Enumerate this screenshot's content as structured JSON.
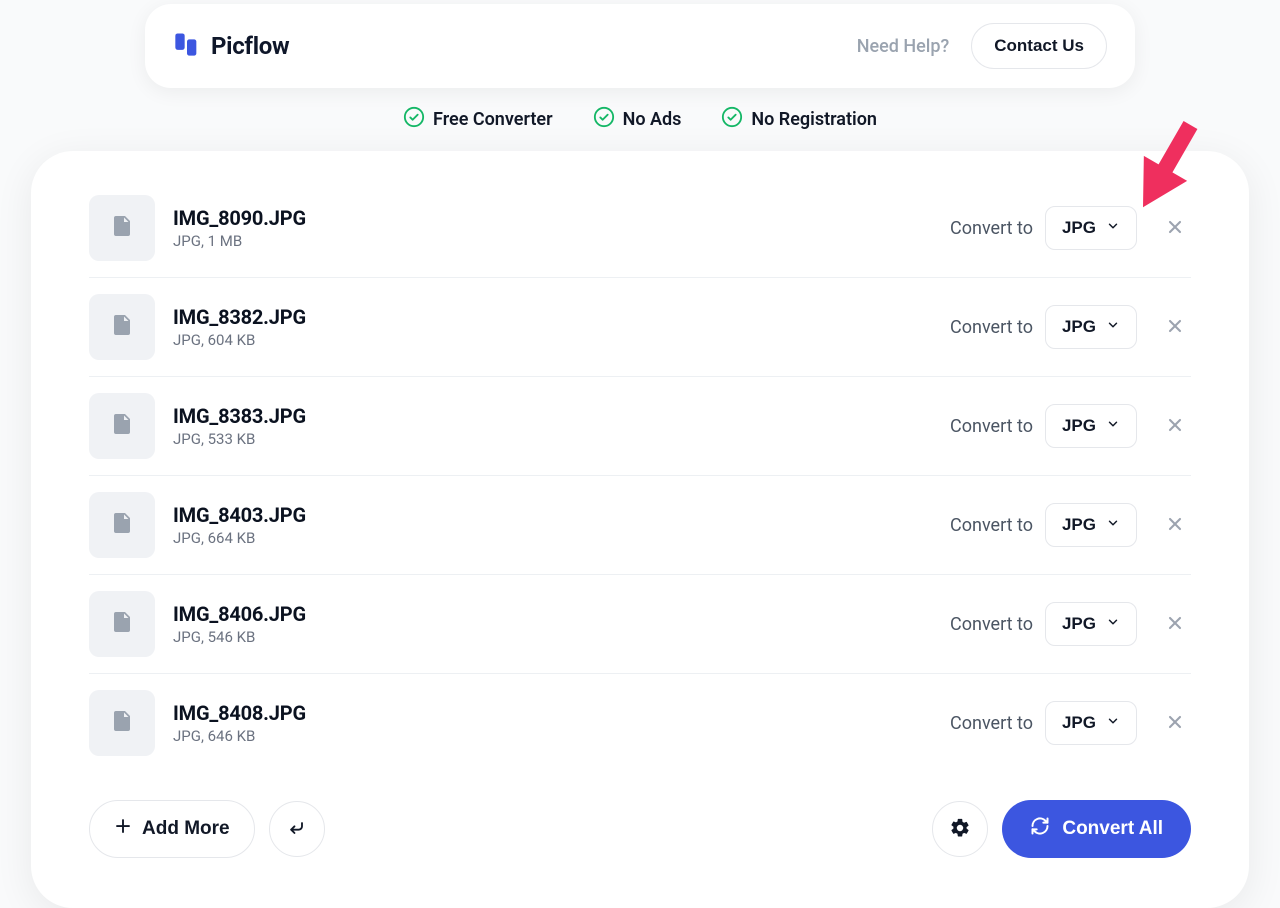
{
  "brand": {
    "name": "Picflow"
  },
  "header": {
    "help": "Need Help?",
    "contact": "Contact Us"
  },
  "features": [
    "Free Converter",
    "No Ads",
    "No Registration"
  ],
  "row_labels": {
    "convert_to": "Convert to"
  },
  "files": [
    {
      "name": "IMG_8090.JPG",
      "type": "JPG",
      "size": "1 MB",
      "target": "JPG"
    },
    {
      "name": "IMG_8382.JPG",
      "type": "JPG",
      "size": "604 KB",
      "target": "JPG"
    },
    {
      "name": "IMG_8383.JPG",
      "type": "JPG",
      "size": "533 KB",
      "target": "JPG"
    },
    {
      "name": "IMG_8403.JPG",
      "type": "JPG",
      "size": "664 KB",
      "target": "JPG"
    },
    {
      "name": "IMG_8406.JPG",
      "type": "JPG",
      "size": "546 KB",
      "target": "JPG"
    },
    {
      "name": "IMG_8408.JPG",
      "type": "JPG",
      "size": "646 KB",
      "target": "JPG"
    }
  ],
  "actions": {
    "add_more": "Add More",
    "convert_all": "Convert All"
  },
  "colors": {
    "accent": "#3C56E0",
    "success": "#14b766",
    "arrow": "#ef2f5e"
  }
}
